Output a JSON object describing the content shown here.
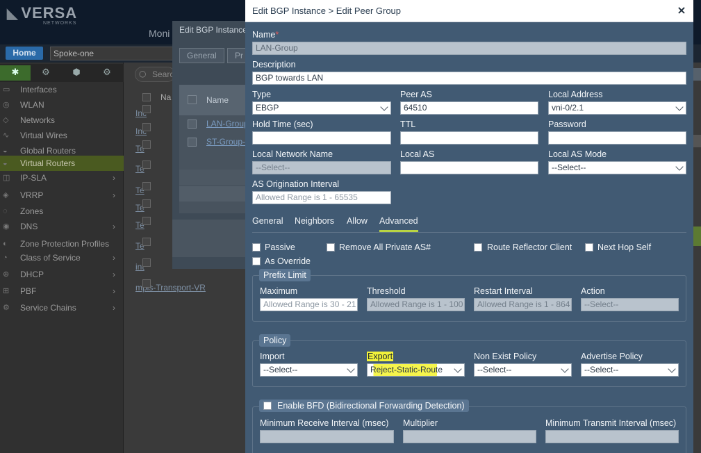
{
  "background": {
    "brand": "VERSA",
    "brand_sub": "NETWORKS",
    "top_nav": "Moni",
    "home_label": "Home",
    "appliance": "Spoke-one",
    "sidebar_items": [
      {
        "label": "Interfaces",
        "icon": "interfaces-icon"
      },
      {
        "label": "WLAN",
        "icon": "wifi-icon"
      },
      {
        "label": "Networks",
        "icon": "network-icon"
      },
      {
        "label": "Virtual Wires",
        "icon": "wire-icon"
      },
      {
        "label": "Global Routers",
        "icon": "router-icon"
      },
      {
        "label": "Virtual Routers",
        "icon": "router-icon"
      },
      {
        "label": "IP-SLA",
        "icon": "sla-icon"
      },
      {
        "label": "VRRP",
        "icon": "vrrp-icon"
      },
      {
        "label": "Zones",
        "icon": "zones-icon"
      },
      {
        "label": "DNS",
        "icon": "dns-icon"
      },
      {
        "label": "Zone Protection Profiles",
        "icon": "shield-icon"
      },
      {
        "label": "Class of Service",
        "icon": "cos-icon"
      },
      {
        "label": "DHCP",
        "icon": "dhcp-icon"
      },
      {
        "label": "PBF",
        "icon": "pbf-icon"
      },
      {
        "label": "Service Chains",
        "icon": "chain-icon"
      }
    ],
    "search_placeholder": "Searc",
    "table_header": "Na",
    "table_rows": [
      "Inc",
      "Inc",
      "Te",
      "Te",
      "Te",
      "Te",
      "Te",
      "Te",
      "int",
      "mpls-Transport-VR"
    ],
    "mid_dialog": {
      "title": "Edit BGP Instance",
      "tabs": [
        "General",
        "Pr"
      ],
      "column_name": "Name",
      "rows": [
        "LAN-Group",
        "ST-Group-"
      ]
    }
  },
  "dialog": {
    "title": "Edit BGP Instance > Edit Peer Group",
    "close_symbol": "×",
    "name_label": "Name",
    "required_mark": "*",
    "name_value": "LAN-Group",
    "description_label": "Description",
    "description_value": "BGP towards LAN",
    "type_label": "Type",
    "type_value": "EBGP",
    "peer_as_label": "Peer AS",
    "peer_as_value": "64510",
    "local_address_label": "Local Address",
    "local_address_value": "vni-0/2.1",
    "hold_time_label": "Hold Time (sec)",
    "hold_time_value": "",
    "ttl_label": "TTL",
    "ttl_value": "",
    "password_label": "Password",
    "password_value": "",
    "local_network_name_label": "Local Network Name",
    "local_network_name_value": "--Select--",
    "local_as_label": "Local AS",
    "local_as_value": "",
    "local_as_mode_label": "Local AS Mode",
    "local_as_mode_value": "--Select--",
    "as_origination_label": "AS Origination Interval",
    "as_origination_placeholder": "Allowed Range is 1 - 65535",
    "tabs": [
      "General",
      "Neighbors",
      "Allow",
      "Advanced"
    ],
    "active_tab": "Advanced",
    "checkboxes": {
      "passive": "Passive",
      "remove_private_as": "Remove All Private AS#",
      "route_reflector_client": "Route Reflector Client",
      "next_hop_self": "Next Hop Self",
      "as_override": "As Override"
    },
    "prefix_limit": {
      "legend": "Prefix Limit",
      "maximum_label": "Maximum",
      "maximum_placeholder": "Allowed Range is 30 - 21",
      "threshold_label": "Threshold",
      "threshold_placeholder": "Allowed Range is 1 - 100",
      "restart_interval_label": "Restart Interval",
      "restart_interval_placeholder": "Allowed Range is 1 - 864",
      "action_label": "Action",
      "action_value": "--Select--"
    },
    "policy": {
      "legend": "Policy",
      "import_label": "Import",
      "import_value": "--Select--",
      "export_label": "Export",
      "export_value": "Reject-Static-Route",
      "non_exist_label": "Non Exist Policy",
      "non_exist_value": "--Select--",
      "advertise_label": "Advertise Policy",
      "advertise_value": "--Select--"
    },
    "bfd": {
      "legend": "Enable BFD (Bidirectional Forwarding Detection)",
      "min_receive_label": "Minimum Receive Interval (msec)",
      "multiplier_label": "Multiplier",
      "min_transmit_label": "Minimum Transmit Interval (msec)"
    }
  },
  "colors": {
    "dialog_bg": "#415a73",
    "legend_bg": "#5a7591",
    "active_tab_underline": "#b9d443",
    "highlight": "#f2f23a",
    "required": "#e05a5a"
  }
}
